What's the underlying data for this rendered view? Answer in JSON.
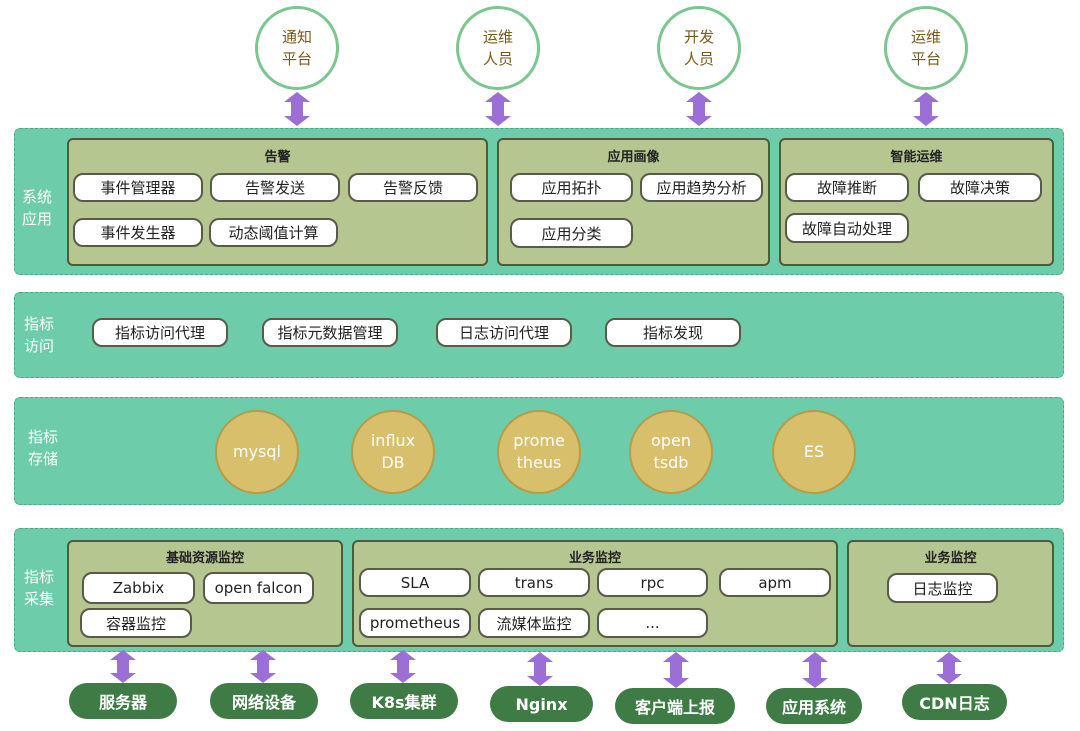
{
  "top_nodes": [
    "通知\n平台",
    "运维\n人员",
    "开发\n人员",
    "运维\n平台"
  ],
  "layers": {
    "app": {
      "label": "系统\n应用",
      "groups": [
        {
          "title": "告警",
          "items": [
            "事件管理器",
            "告警发送",
            "告警反馈",
            "事件发生器",
            "动态阈值计算"
          ]
        },
        {
          "title": "应用画像",
          "items": [
            "应用拓扑",
            "应用趋势分析",
            "应用分类"
          ]
        },
        {
          "title": "智能运维",
          "items": [
            "故障推断",
            "故障决策",
            "故障自动处理"
          ]
        }
      ]
    },
    "access": {
      "label": "指标\n访问",
      "items": [
        "指标访问代理",
        "指标元数据管理",
        "日志访问代理",
        "指标发现"
      ]
    },
    "storage": {
      "label": "指标\n存储",
      "items": [
        "mysql",
        "influx\nDB",
        "prome\ntheus",
        "open\ntsdb",
        "ES"
      ]
    },
    "collect": {
      "label": "指标\n采集",
      "groups": [
        {
          "title": "基础资源监控",
          "items": [
            "Zabbix",
            "open falcon",
            "容器监控"
          ]
        },
        {
          "title": "业务监控",
          "items": [
            "SLA",
            "trans",
            "rpc",
            "apm",
            "prometheus",
            "流媒体监控",
            "..."
          ]
        },
        {
          "title": "业务监控",
          "items": [
            "日志监控"
          ]
        }
      ]
    }
  },
  "sources": [
    "服务器",
    "网络设备",
    "K8s集群",
    "Nginx",
    "客户端上报",
    "应用系统",
    "CDN日志"
  ],
  "colors": {
    "band": "#6dcca9",
    "box": "#b6c690",
    "storage": "#d8bf6c",
    "source": "#3f7c45",
    "arrow": "#9b6fd6"
  }
}
